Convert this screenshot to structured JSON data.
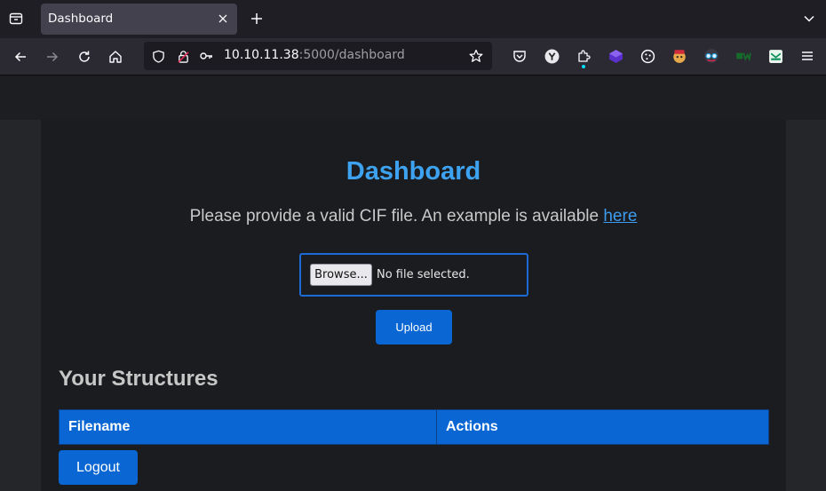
{
  "browser": {
    "tab_title": "Dashboard",
    "url_host": "10.10.11.38",
    "url_rest": ":5000/dashboard",
    "icons": [
      "tab-list-icon",
      "close-icon",
      "plus-icon",
      "chevron-down-icon",
      "back-icon",
      "forward-icon",
      "reload-icon",
      "home-icon",
      "shield-icon",
      "lock-warning-icon",
      "key-icon",
      "star-icon",
      "pocket-icon",
      "y-extension-icon",
      "extensions-icon",
      "purple-cube-extension-icon",
      "cookie-extension-icon",
      "fox-extension-icon",
      "glasses-extension-icon",
      "bw-extension-icon",
      "mail-extension-icon",
      "menu-icon"
    ]
  },
  "page": {
    "title": "Dashboard",
    "lead_text": "Please provide a valid CIF file. An example is available ",
    "lead_link": "here",
    "browse_label": "Browse...",
    "file_status": "No file selected.",
    "upload_label": "Upload",
    "section_title": "Your Structures",
    "table_headers": [
      "Filename",
      "Actions"
    ],
    "logout_label": "Logout"
  },
  "colors": {
    "accent": "#0a66d2",
    "title": "#3da3f0",
    "link": "#3d9cf0"
  }
}
